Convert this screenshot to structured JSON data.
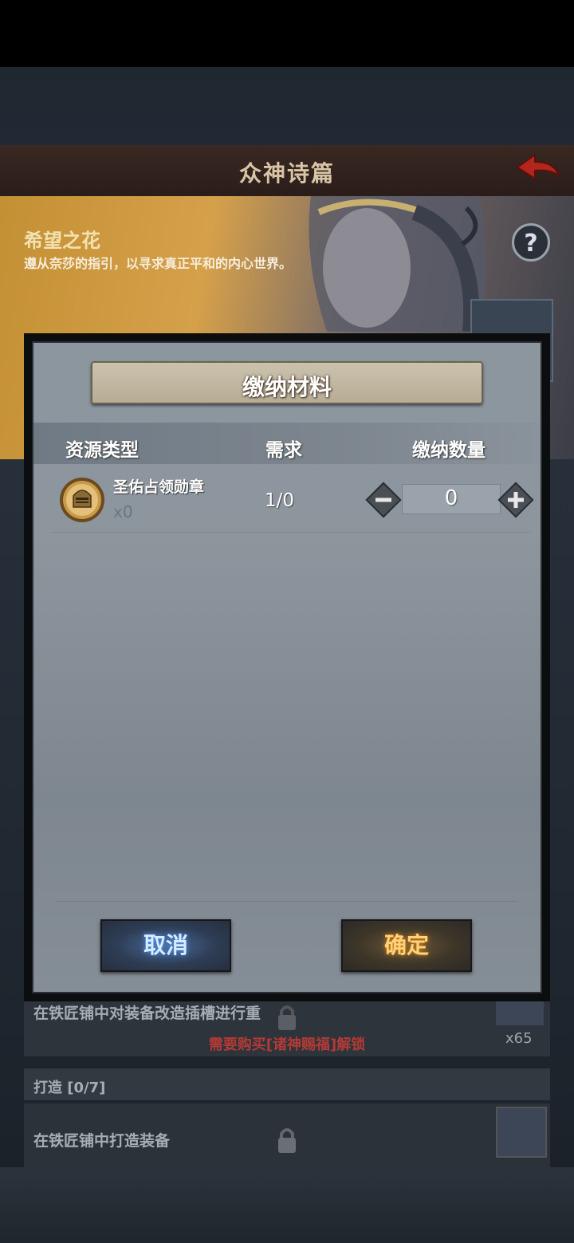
{
  "screen": {
    "title": "众神诗篇",
    "banner": {
      "title": "希望之花",
      "description": "遵从奈莎的指引，以寻求真正平和的内心世界。"
    },
    "help_label": "?",
    "tasks": [
      {
        "text": "在铁匠铺中对装备改造插槽进行重",
        "lock_message": "需要购买[诸神赐福]解锁",
        "reward_count": "x65"
      },
      {
        "text": "在铁匠铺中打造装备"
      }
    ],
    "section_label": "打造 [0/7]"
  },
  "dialog": {
    "title": "缴纳材料",
    "headers": {
      "type": "资源类型",
      "need": "需求",
      "amount": "缴纳数量"
    },
    "items": [
      {
        "name": "圣佑占领勋章",
        "owned": "x0",
        "need": "1/0",
        "amount": "0"
      }
    ],
    "cancel_label": "取消",
    "confirm_label": "确定"
  },
  "colors": {
    "cancel_glow": "#5aa0ff",
    "confirm_glow": "#e08a20",
    "lock_text": "#b33a35"
  },
  "icons": [
    "back-arrow-icon",
    "help-icon",
    "chest-icon",
    "knight-helmet-medal-icon",
    "minus-icon",
    "plus-icon",
    "lock-icon"
  ]
}
